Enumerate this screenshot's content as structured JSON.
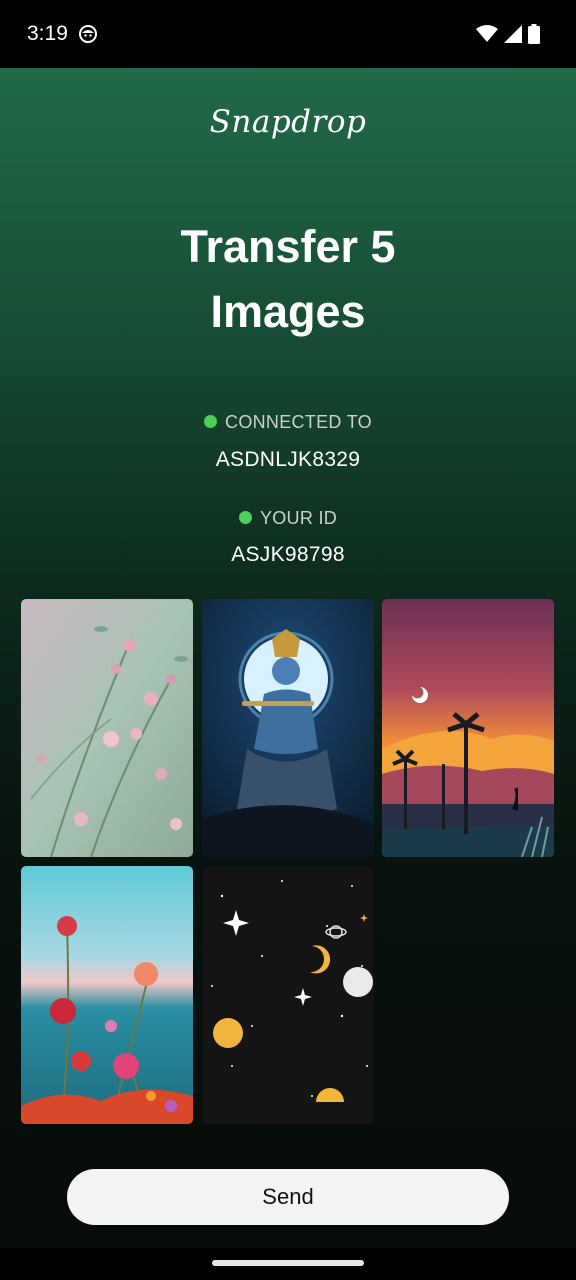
{
  "status_bar": {
    "time": "3:19",
    "icons": [
      "notification-face-icon",
      "wifi-icon",
      "signal-icon",
      "battery-icon"
    ]
  },
  "app": {
    "logo": "Snapdrop",
    "title_line1": "Transfer 5",
    "title_line2": "Images",
    "connected_label": "CONNECTED TO",
    "connected_id": "ASDNLJK8329",
    "your_id_label": "YOUR ID",
    "your_id": "ASJK98798",
    "status_dot_color": "#4cd05a",
    "images": [
      {
        "name": "pink-flowers-image"
      },
      {
        "name": "krishna-flute-moon-image"
      },
      {
        "name": "sunset-palms-heron-image"
      },
      {
        "name": "red-flowers-sea-image"
      },
      {
        "name": "space-moons-stars-image"
      }
    ],
    "send_label": "Send"
  }
}
